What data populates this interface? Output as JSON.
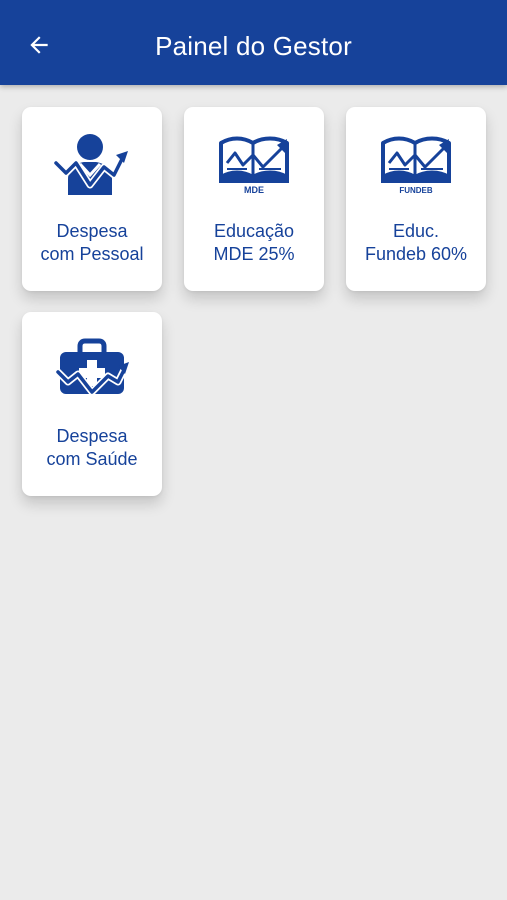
{
  "appbar": {
    "title": "Painel do Gestor",
    "back_icon": "arrow-left-icon",
    "background_color": "#16429a",
    "text_color": "#ffffff"
  },
  "cards": [
    {
      "id": "despesa-pessoal",
      "icon": "person-chart-icon",
      "label_line1": "Despesa",
      "label_line2": "com Pessoal"
    },
    {
      "id": "educacao-mde",
      "icon": "book-chart-mde-icon",
      "icon_text": "MDE",
      "label_line1": "Educação",
      "label_line2": "MDE 25%"
    },
    {
      "id": "educ-fundeb",
      "icon": "book-chart-fundeb-icon",
      "icon_text": "FUNDEB",
      "label_line1": "Educ.",
      "label_line2": "Fundeb 60%"
    },
    {
      "id": "despesa-saude",
      "icon": "medical-bag-chart-icon",
      "label_line1": "Despesa",
      "label_line2": "com Saúde"
    }
  ],
  "colors": {
    "accent": "#16429a",
    "background": "#ebebeb",
    "card": "#ffffff"
  }
}
